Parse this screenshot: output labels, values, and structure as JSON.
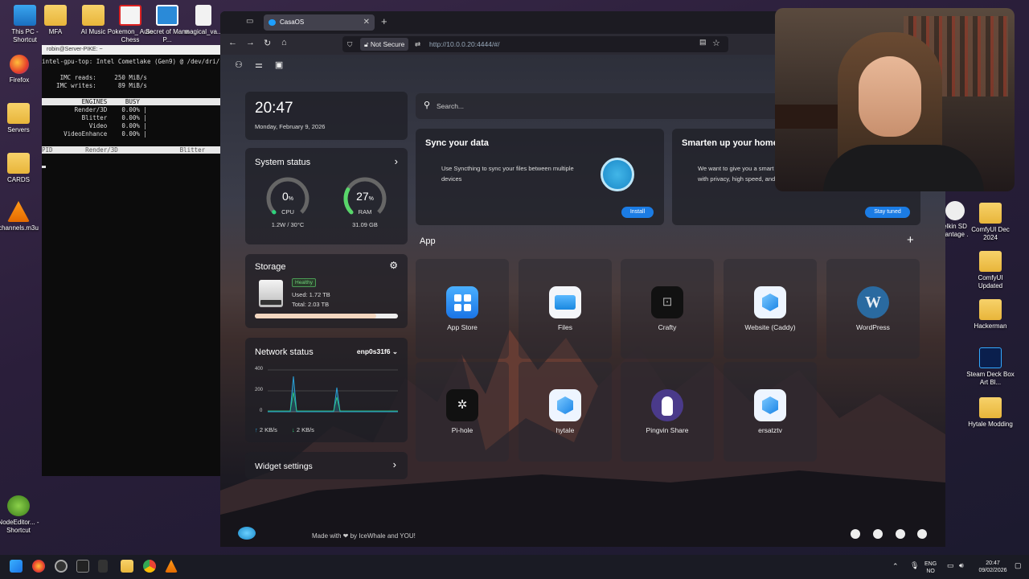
{
  "desktop": {
    "left_icons": [
      {
        "label": "This PC - Shortcut",
        "icon": "pc-icon"
      },
      {
        "label": "Firefox",
        "icon": "firefox-icon"
      },
      {
        "label": "Servers",
        "icon": "folder-icon"
      },
      {
        "label": "CARDS",
        "icon": "folder-icon"
      },
      {
        "label": "channels.m3u",
        "icon": "vlc-icon"
      },
      {
        "label": "NodeEditor... - Shortcut",
        "icon": "app-icon"
      }
    ],
    "top_icons": [
      {
        "label": "MFA",
        "icon": "folder-icon"
      },
      {
        "label": "AI Music",
        "icon": "folder-icon"
      },
      {
        "label": "Pokemon_ Auto Chess",
        "icon": "game-icon"
      },
      {
        "label": "Secret of Mana P...",
        "icon": "file-icon"
      },
      {
        "label": "magical_va...",
        "icon": "file-icon"
      }
    ],
    "right_icons": [
      {
        "label": "ComfyUI Dec 2024",
        "icon": "folder-icon"
      },
      {
        "label": "ComfyUI Updated",
        "icon": "folder-icon"
      },
      {
        "label": "Hackerman",
        "icon": "folder-icon"
      },
      {
        "label": "Steam Deck Box Art Bl...",
        "icon": "photoshop-icon"
      },
      {
        "label": "Hytale Modding",
        "icon": "folder-icon"
      }
    ],
    "partial_icon_label": "elkin SD vantage ."
  },
  "terminal": {
    "title": "robin@Server-PIKE: ~",
    "header": "intel-gpu-top: Intel Cometlake (Gen9) @ /dev/dri/c",
    "imc_reads": "     IMC reads:     250 MiB/s",
    "imc_writes": "    IMC writes:      89 MiB/s",
    "engines_header": "           ENGINES     BUSY",
    "engines": [
      "         Render/3D    0.00% |",
      "           Blitter    0.00% |",
      "             Video    0.00% |",
      "      VideoEnhance    0.00% |"
    ],
    "pid_header": "PID         Render/3D                 Blitter"
  },
  "browser": {
    "tab_title": "CasaOS",
    "security": "Not Secure",
    "url": "http://10.0.0.20:4444/#/"
  },
  "casa": {
    "time": "20:47",
    "date": "Monday, February 9, 2026",
    "search_placeholder": "Search...",
    "system_status": {
      "title": "System status",
      "cpu_value": "0",
      "cpu_unit": "%",
      "cpu_label": "CPU",
      "cpu_detail": "1.2W / 30°C",
      "ram_value": "27",
      "ram_unit": "%",
      "ram_label": "RAM",
      "ram_detail": "31.09 GB",
      "cpu_fraction": 0.0,
      "ram_fraction": 0.27
    },
    "storage": {
      "title": "Storage",
      "badge": "Healthy",
      "used": "Used: 1.72 TB",
      "total": "Total: 2.03 TB",
      "fraction": 0.85
    },
    "network": {
      "title": "Network status",
      "interface": "enp0s31f6",
      "y_ticks": [
        "400",
        "200",
        "0"
      ],
      "up": "2 KB/s",
      "down": "2 KB/s"
    },
    "widget_settings": "Widget settings",
    "sync_card": {
      "title": "Sync your data",
      "body": "Use Syncthing to sync your files between multiple devices",
      "button": "Install"
    },
    "home_card": {
      "title": "Smarten up your home",
      "body": "We want to give you a smart ... with privacy, high speed, and ...",
      "button": "Stay tuned"
    },
    "app_section": "App",
    "apps": [
      {
        "label": "App Store",
        "icon": "app-store-icon"
      },
      {
        "label": "Files",
        "icon": "files-icon"
      },
      {
        "label": "Crafty",
        "icon": "crafty-icon"
      },
      {
        "label": "Website (Caddy)",
        "icon": "caddy-icon"
      },
      {
        "label": "WordPress",
        "icon": "wordpress-icon"
      },
      {
        "label": "Pi-hole",
        "icon": "pihole-icon"
      },
      {
        "label": "hytale",
        "icon": "hytale-icon"
      },
      {
        "label": "Pingvin Share",
        "icon": "pingvin-icon"
      },
      {
        "label": "ersatztv",
        "icon": "ersatztv-icon"
      }
    ],
    "footer": "Made with ❤ by IceWhale and YOU!"
  },
  "taskbar": {
    "lang1": "ENG",
    "lang2": "NO",
    "time": "20:47",
    "date": "09/02/2026"
  },
  "colors": {
    "accent": "#1b7ce4",
    "cpu_gauge": "#2ed37c",
    "ram_gauge": "#58d66a"
  }
}
